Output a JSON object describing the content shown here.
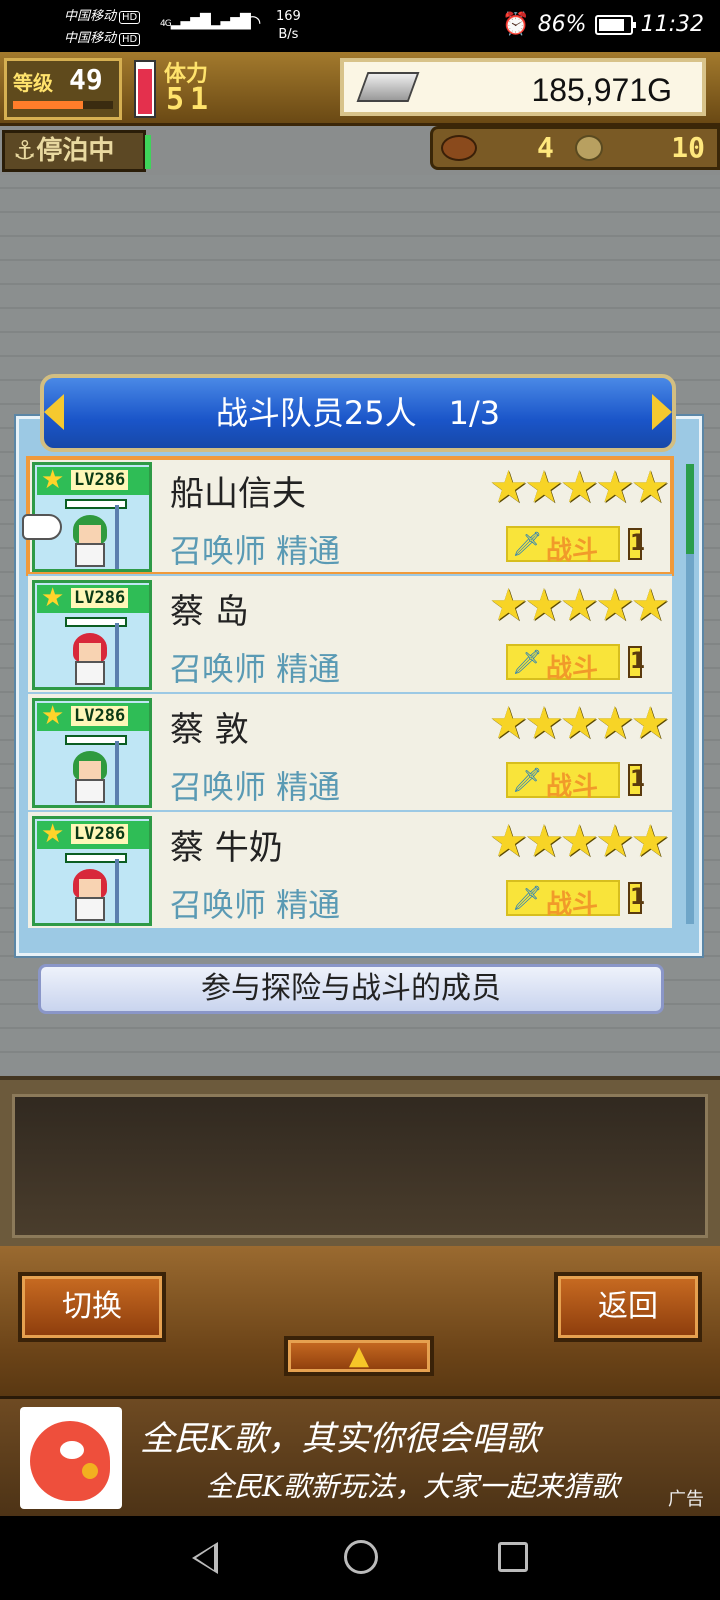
{
  "status_bar": {
    "carrier1": "中国移动",
    "carrier2": "中国移动",
    "hd": "HD",
    "net_type": "4G",
    "speed_value": "169",
    "speed_unit": "B/s",
    "battery_percent": "86%",
    "battery_level": 0.86,
    "time": "11:32",
    "icons": [
      "signal-icon",
      "wifi-icon",
      "alarm-icon",
      "battery-icon"
    ]
  },
  "hud": {
    "level_label": "等级",
    "level_value": "49",
    "xp_fraction": 0.7,
    "stamina_label": "体力",
    "stamina_value": "51",
    "stamina_fraction": 0.9,
    "gold_value": "185,971G",
    "docked_label": "停泊中",
    "resource1_value": "4",
    "resource2_value": "10"
  },
  "roster": {
    "title": "战斗队员25人　1/3",
    "caption": "参与探险与战斗的成员",
    "members": [
      {
        "name": "船山信夫",
        "job": "召唤师 精通",
        "level": "LV286",
        "stars": "★★★★★",
        "role": "战斗",
        "rank": "1",
        "hair": "#2f9a3e",
        "selected": true
      },
      {
        "name": "蔡 岛",
        "job": "召唤师 精通",
        "level": "LV286",
        "stars": "★★★★★",
        "role": "战斗",
        "rank": "1",
        "hair": "#d8283a",
        "selected": false
      },
      {
        "name": "蔡 敦",
        "job": "召唤师 精通",
        "level": "LV286",
        "stars": "★★★★★",
        "role": "战斗",
        "rank": "1",
        "hair": "#2f9a3e",
        "selected": false
      },
      {
        "name": "蔡 牛奶",
        "job": "召唤师 精通",
        "level": "LV286",
        "stars": "★★★★★",
        "role": "战斗",
        "rank": "1",
        "hair": "#d8283a",
        "selected": false
      }
    ]
  },
  "controls": {
    "switch_label": "切换",
    "back_label": "返回",
    "up_label": "▲"
  },
  "ad": {
    "title": "全民K歌，其实你很会唱歌",
    "subtitle": "全民K歌新玩法，大家一起来猜歌",
    "tag": "广告"
  }
}
